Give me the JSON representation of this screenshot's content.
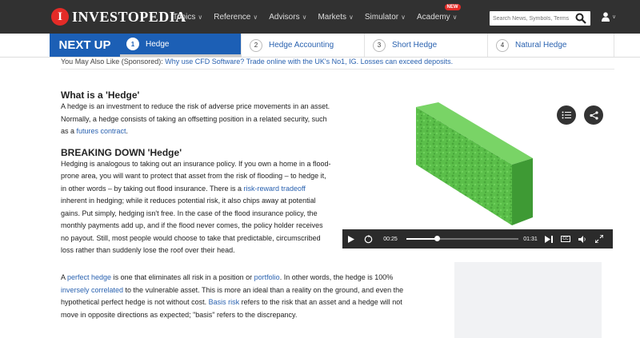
{
  "header": {
    "logo_mark": "I",
    "brand": "INVESTOPEDIA",
    "nav": [
      {
        "label": "Topics"
      },
      {
        "label": "Reference"
      },
      {
        "label": "Advisors"
      },
      {
        "label": "Markets"
      },
      {
        "label": "Simulator"
      },
      {
        "label": "Academy",
        "badge": "NEW"
      }
    ],
    "search_placeholder": "Search News, Symbols, Terms"
  },
  "next_up": {
    "label": "NEXT UP",
    "tabs": [
      {
        "num": "1",
        "label": "Hedge",
        "active": true
      },
      {
        "num": "2",
        "label": "Hedge Accounting"
      },
      {
        "num": "3",
        "label": "Short Hedge"
      },
      {
        "num": "4",
        "label": "Natural Hedge"
      }
    ]
  },
  "sponsored": {
    "prefix": "You May Also Like (Sponsored):",
    "link": "Why use CFD Software? Trade online with the UK's No1, IG. Losses can exceed deposits."
  },
  "article": {
    "section1": {
      "heading": "What is a 'Hedge'",
      "text_before": "A hedge is an investment to reduce the risk of adverse price movements in an asset. Normally, a hedge consists of taking an offsetting position in a related security, such as a ",
      "link": "futures contract",
      "text_after": "."
    },
    "section2": {
      "heading": "BREAKING DOWN 'Hedge'",
      "text_before": "Hedging is analogous to taking out an insurance policy. If you own a home in a flood-prone area, you will want to protect that asset from the risk of flooding – to hedge it, in other words – by taking out flood insurance. There is a ",
      "link": "risk-reward tradeoff",
      "text_after": " inherent in hedging; while it reduces potential risk, it also chips away at potential gains. Put simply, hedging isn't free. In the case of the flood insurance policy, the monthly payments add up, and if the flood never comes, the policy holder receives no payout. Still, most people would choose to take that predictable, circumscribed loss rather than suddenly lose the roof over their head."
    },
    "section3": {
      "t1": "A ",
      "link1": "perfect hedge",
      "t2": " is one that eliminates all risk in a position or ",
      "link2": "portfolio",
      "t3": ". In other words, the hedge is 100% ",
      "link3": "inversely correlated",
      "t4": " to the vulnerable asset. This is more an ideal than a reality on the ground, and even the hypothetical perfect hedge is not without cost. ",
      "link4": "Basis risk",
      "t5": " refers to the risk that an asset and a hedge will not move in opposite directions as expected; \"basis\" refers to the discrepancy."
    }
  },
  "video": {
    "current_time": "00:25",
    "duration": "01:31",
    "progress": 0.27,
    "cc_label": "CC",
    "colors": {
      "hedge_green": "#5bbf4a",
      "hedge_dark": "#3e9a34"
    }
  },
  "colors": {
    "topbar": "#313131",
    "accent_blue": "#1c5fb5",
    "link_blue": "#2a62b0",
    "brand_red": "#e42b27"
  }
}
